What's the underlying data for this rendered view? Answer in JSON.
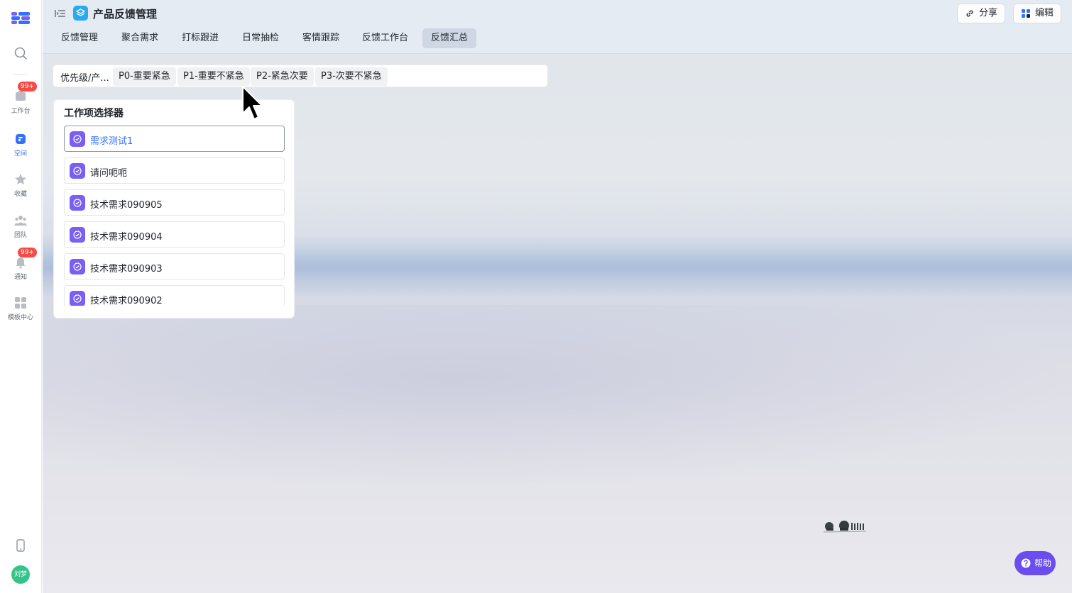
{
  "app": {
    "title": "产品反馈管理"
  },
  "rail": {
    "items": [
      {
        "label": "工作台",
        "icon": "workbench-icon",
        "badge": "99+"
      },
      {
        "label": "空间",
        "icon": "space-icon",
        "active": true
      },
      {
        "label": "收藏",
        "icon": "star-icon"
      },
      {
        "label": "团队",
        "icon": "team-icon"
      },
      {
        "label": "通知",
        "icon": "bell-icon",
        "badge": "99+"
      },
      {
        "label": "模板中心",
        "icon": "template-icon"
      }
    ],
    "avatar": "刘梦"
  },
  "header": {
    "share_label": "分享",
    "edit_label": "编辑"
  },
  "tabs": [
    {
      "label": "反馈管理"
    },
    {
      "label": "聚合需求"
    },
    {
      "label": "打标跟进"
    },
    {
      "label": "日常抽检"
    },
    {
      "label": "客情跟踪"
    },
    {
      "label": "反馈工作台"
    },
    {
      "label": "反馈汇总",
      "active": true
    }
  ],
  "filter": {
    "label": "优先级/产...",
    "chips": [
      "P0-重要紧急",
      "P1-重要不紧急",
      "P2-紧急次要",
      "P3-次要不紧急"
    ]
  },
  "selector": {
    "title": "工作项选择器",
    "items": [
      {
        "label": "需求测试1",
        "selected": true
      },
      {
        "label": "请问呃呃"
      },
      {
        "label": "技术需求090905"
      },
      {
        "label": "技术需求090904"
      },
      {
        "label": "技术需求090903"
      },
      {
        "label": "技术需求090902"
      }
    ]
  },
  "help": {
    "label": "帮助"
  },
  "colors": {
    "accent": "#3370ff",
    "item_icon": "#7b5ff5",
    "help_button": "#6a4cf0",
    "badge": "#f54a45",
    "app_icon": "#2aa9f0"
  }
}
